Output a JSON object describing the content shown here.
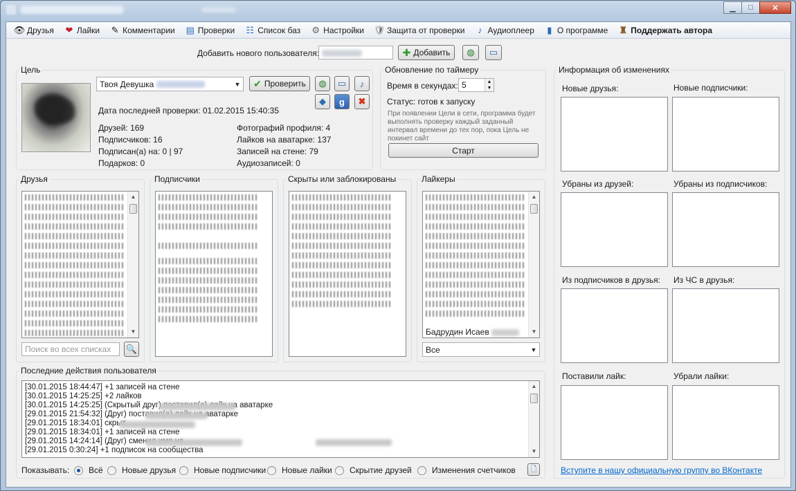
{
  "menu": {
    "items": [
      {
        "label": "Друзья",
        "icon": "👁"
      },
      {
        "label": "Лайки",
        "icon": "❤"
      },
      {
        "label": "Комментарии",
        "icon": "✎"
      },
      {
        "label": "Проверки",
        "icon": "▤"
      },
      {
        "label": "Список баз",
        "icon": "☷"
      },
      {
        "label": "Настройки",
        "icon": "⚙"
      },
      {
        "label": "Защита от проверки",
        "icon": "🛡"
      },
      {
        "label": "Аудиоплеер",
        "icon": "♪"
      },
      {
        "label": "О программе",
        "icon": "▮"
      },
      {
        "label": "Поддержать автора",
        "icon": "♜"
      }
    ]
  },
  "add_user": {
    "label": "Добавить нового пользователя:",
    "value": "",
    "button": "Добавить"
  },
  "target": {
    "legend": "Цель",
    "name": "Твоя Девушка",
    "check_button": "Проверить",
    "last_check": "Дата последней проверки: 01.02.2015 15:40:35",
    "stats_left": [
      "Друзей: 169",
      "Подписчиков: 16",
      "Подписан(а) на: 0 | 97",
      "Подарков: 0"
    ],
    "stats_right": [
      "Фотографий профиля: 4",
      "Лайков на аватарке: 137",
      "Записей на стене: 79",
      "Аудиозаписей: 0"
    ]
  },
  "timer": {
    "legend": "Обновление по таймеру",
    "seconds_label": "Время в секундах:",
    "seconds": "5",
    "status": "Статус: готов к запуску",
    "hint": "При появлении Цели в сети, программа будет выполнять проверку каждый заданный интервал времени до тех пор, пока Цель не покинет сайт",
    "start_button": "Старт"
  },
  "lists": {
    "friends": "Друзья",
    "subscribers": "Подписчики",
    "hidden": "Скрыты или заблокированы",
    "likers": "Лайкеры",
    "search_placeholder": "Поиск во всех списках",
    "likers_last": "Бадрудин Исаев",
    "likers_filter": "Все"
  },
  "actions": {
    "legend": "Последние действия пользователя",
    "lines": [
      "[30.01.2015 18:44:47] +1 записей на стене",
      "[30.01.2015 14:25:25] +2 лайков",
      "[30.01.2015 14:25:25] (Скрытый друг)                          поставил(а) лайк на аватарке",
      "[29.01.2015 21:54:32] (Друг)                     поставил(а) лайк на аватарке",
      "[29.01.2015 18:34:01]                              скрыт",
      "[29.01.2015 18:34:01] +1 записей на стене",
      "[29.01.2015 14:24:14] (Друг)                              сменил имя на",
      "[29.01.2015 0:30:24] +1 подписок на сообщества"
    ],
    "show_label": "Показывать:",
    "filters": [
      "Всё",
      "Новые друзья",
      "Новые подписчики",
      "Новые лайки",
      "Скрытие друзей",
      "Изменения счетчиков"
    ],
    "selected_filter": "Всё"
  },
  "changes": {
    "legend": "Информация об изменениях",
    "boxes": [
      "Новые друзья:",
      "Новые подписчики:",
      "Убраны из друзей:",
      "Убраны из подписчиков:",
      "Из подписчиков в друзья:",
      "Из ЧС в друзья:",
      "Поставили лайк:",
      "Убрали лайки:"
    ],
    "link": "Вступите в нашу официальную группу во ВКонтакте"
  }
}
